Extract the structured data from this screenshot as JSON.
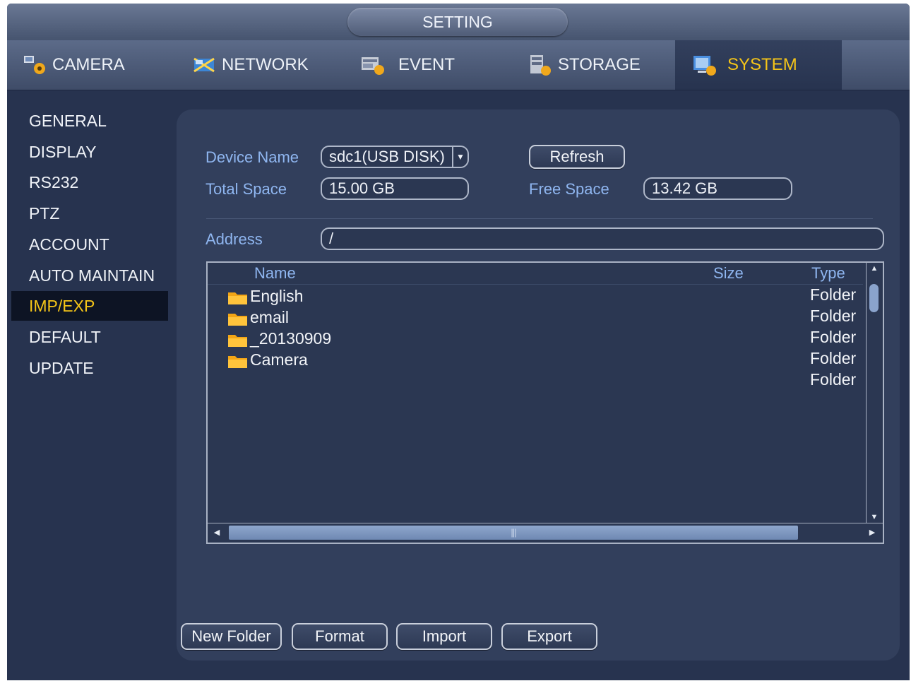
{
  "window": {
    "title": "SETTING"
  },
  "tabs": [
    {
      "label": "CAMERA",
      "icon": "camera-settings-icon"
    },
    {
      "label": "NETWORK",
      "icon": "network-icon"
    },
    {
      "label": "EVENT",
      "icon": "event-icon"
    },
    {
      "label": "STORAGE",
      "icon": "storage-icon"
    },
    {
      "label": "SYSTEM",
      "icon": "system-icon",
      "active": true
    }
  ],
  "sidebar": {
    "items": [
      {
        "label": "GENERAL"
      },
      {
        "label": "DISPLAY"
      },
      {
        "label": "RS232"
      },
      {
        "label": "PTZ"
      },
      {
        "label": "ACCOUNT"
      },
      {
        "label": "AUTO MAINTAIN"
      },
      {
        "label": "IMP/EXP",
        "active": true
      },
      {
        "label": "DEFAULT"
      },
      {
        "label": "UPDATE"
      }
    ]
  },
  "device": {
    "name_label": "Device Name",
    "name_value": "sdc1(USB DISK)",
    "refresh_label": "Refresh",
    "total_label": "Total Space",
    "total_value": "15.00 GB",
    "free_label": "Free Space",
    "free_value": "13.42 GB",
    "address_label": "Address",
    "address_value": "/"
  },
  "filelist": {
    "columns": {
      "name": "Name",
      "size": "Size",
      "type": "Type"
    },
    "rows": [
      {
        "name": "English",
        "size": "",
        "type": "Folder"
      },
      {
        "name": "email",
        "size": "",
        "type": "Folder"
      },
      {
        "name": "_20130909",
        "size": "",
        "type": "Folder"
      },
      {
        "name": "Camera",
        "size": "",
        "type": "Folder"
      }
    ],
    "extra_type": "Folder",
    "hscroll_grip": "|||"
  },
  "actions": {
    "new_folder": "New Folder",
    "format": "Format",
    "import": "Import",
    "export": "Export"
  },
  "colors": {
    "background": "#27334f",
    "panel": "#323f5c",
    "accent": "#f5c518",
    "label": "#8fb6f0"
  }
}
